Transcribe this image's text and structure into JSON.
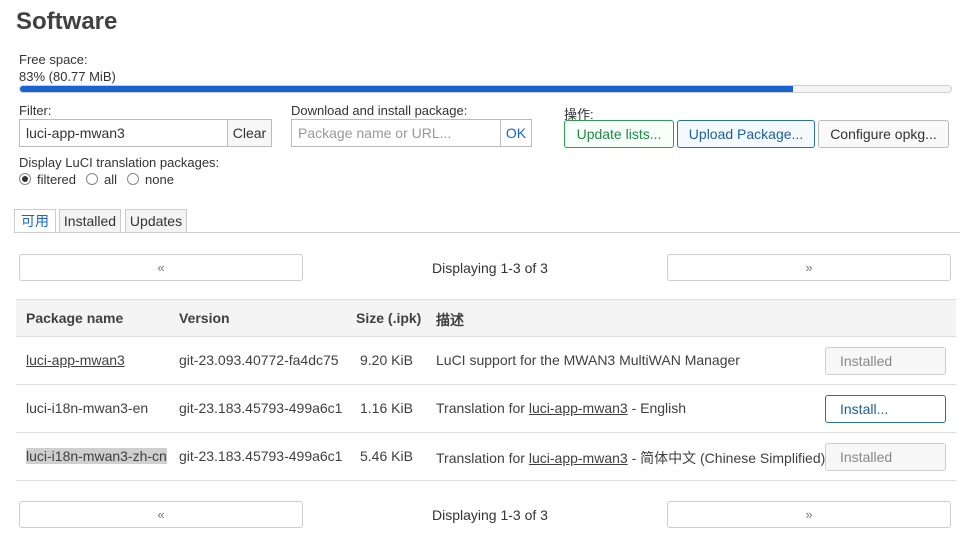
{
  "page": {
    "title": "Software"
  },
  "free_space": {
    "label": "Free space:",
    "value": "83% (80.77 MiB)",
    "percent": 83
  },
  "filter": {
    "label": "Filter:",
    "value": "luci-app-mwan3",
    "clear_label": "Clear"
  },
  "download": {
    "label": "Download and install package:",
    "placeholder": "Package name or URL...",
    "ok_label": "OK"
  },
  "actions": {
    "label": "操作:",
    "update_label": "Update lists...",
    "upload_label": "Upload Package...",
    "configure_label": "Configure opkg..."
  },
  "translation": {
    "label": "Display LuCI translation packages:",
    "options": [
      "filtered",
      "all",
      "none"
    ],
    "selected": "filtered"
  },
  "tabs": [
    {
      "label": "可用",
      "active": true
    },
    {
      "label": "Installed",
      "active": false
    },
    {
      "label": "Updates",
      "active": false
    }
  ],
  "pager": {
    "prev_label": "«",
    "next_label": "»",
    "status": "Displaying 1-3 of 3"
  },
  "table": {
    "headers": [
      "Package name",
      "Version",
      "Size (.ipk)",
      "描述"
    ],
    "rows": [
      {
        "name": "luci-app-mwan3",
        "version": "git-23.093.40772-fa4dc75",
        "size": "9.20 KiB",
        "desc_prefix": "LuCI support for the MWAN3 MultiWAN Manager",
        "desc_link": "",
        "desc_suffix": "",
        "action": "Installed"
      },
      {
        "name": "luci-i18n-mwan3-en",
        "version": "git-23.183.45793-499a6c1",
        "size": "1.16 KiB",
        "desc_prefix": "Translation for ",
        "desc_link": "luci-app-mwan3",
        "desc_suffix": " - English",
        "action": "Install..."
      },
      {
        "name": "luci-i18n-mwan3-zh-cn",
        "version": "git-23.183.45793-499a6c1",
        "size": "5.46 KiB",
        "desc_prefix": "Translation for ",
        "desc_link": "luci-app-mwan3",
        "desc_suffix": " - 简体中文 (Chinese Simplified)",
        "action": "Installed"
      }
    ]
  },
  "colors": {
    "accent": "#1763cf",
    "success": "#1f8a43"
  }
}
